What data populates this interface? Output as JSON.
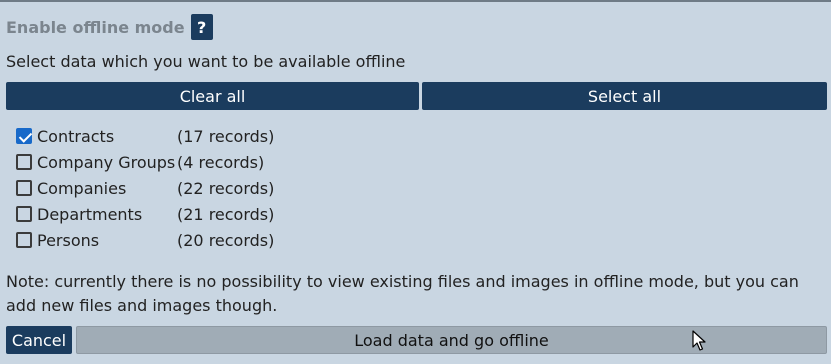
{
  "dialog": {
    "title": "Enable offline mode",
    "help_label": "?",
    "subtitle": "Select data which you want to be available offline",
    "clear_all_label": "Clear all",
    "select_all_label": "Select all",
    "items": [
      {
        "label": "Contracts",
        "count": "(17 records)",
        "checked": true
      },
      {
        "label": "Company Groups",
        "count": "(4 records)",
        "checked": false
      },
      {
        "label": "Companies",
        "count": "(22 records)",
        "checked": false
      },
      {
        "label": "Departments",
        "count": "(21 records)",
        "checked": false
      },
      {
        "label": "Persons",
        "count": "(20 records)",
        "checked": false
      }
    ],
    "note": "Note: currently there is no possibility to view existing files and images in offline mode, but you can add new files and images though.",
    "cancel_label": "Cancel",
    "load_label": "Load data and go offline"
  },
  "colors": {
    "background": "#c9d6e2",
    "button_dark": "#1b3c5e",
    "button_disabled": "#a0acb6",
    "checkbox_checked": "#1769c9",
    "title_text": "#7b858e"
  }
}
